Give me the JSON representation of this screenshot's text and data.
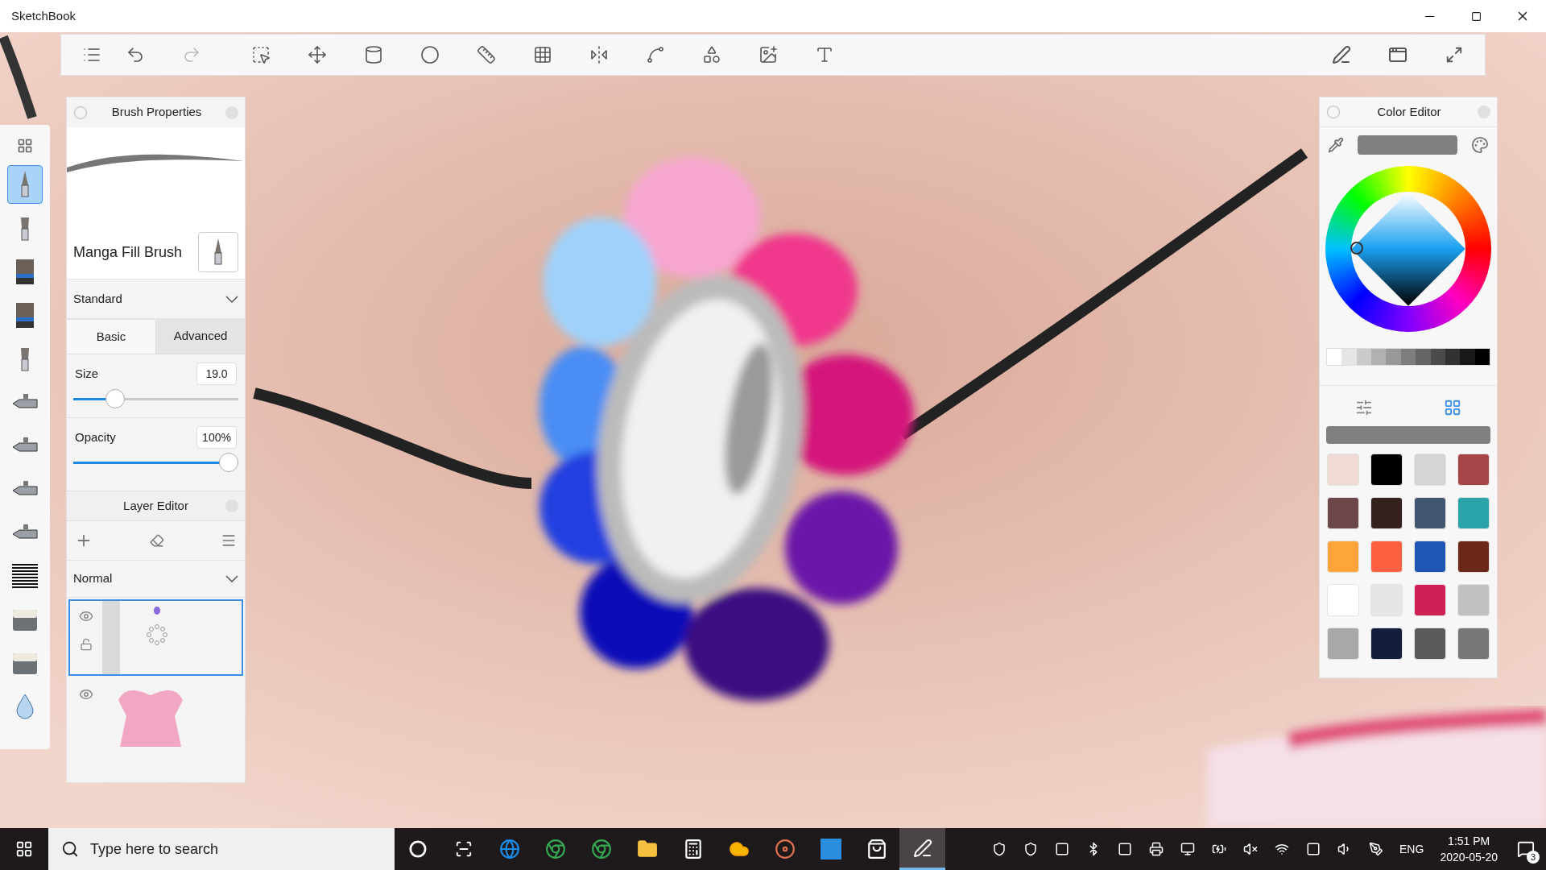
{
  "window": {
    "title": "SketchBook"
  },
  "toolbar": {
    "redo": {
      "disabled": true
    }
  },
  "brush_strip": {
    "brushes": [
      {
        "kind": "pen",
        "selected": true
      },
      {
        "kind": "brush",
        "selected": false
      },
      {
        "kind": "flat",
        "selected": false
      },
      {
        "kind": "flat",
        "selected": false
      },
      {
        "kind": "brush",
        "selected": false
      },
      {
        "kind": "airbrush",
        "selected": false
      },
      {
        "kind": "airbrush",
        "selected": false
      },
      {
        "kind": "airbrush",
        "selected": false
      },
      {
        "kind": "airbrush",
        "selected": false
      },
      {
        "kind": "hatch",
        "selected": false
      },
      {
        "kind": "eraser",
        "selected": false
      },
      {
        "kind": "eraser",
        "selected": false
      },
      {
        "kind": "drop",
        "selected": false
      }
    ]
  },
  "brush_properties": {
    "title": "Brush Properties",
    "brush_name": "Manga Fill Brush",
    "preset": "Standard",
    "tabs": [
      {
        "label": "Basic",
        "selected": true
      },
      {
        "label": "Advanced",
        "selected": false
      }
    ],
    "size": {
      "label": "Size",
      "value": "19.0",
      "level": 0.22
    },
    "opacity": {
      "label": "Opacity",
      "value": "100%",
      "level": 1.0
    }
  },
  "layer_editor": {
    "title": "Layer Editor",
    "blend_mode": "Normal",
    "layers": [
      {
        "kind": "gems",
        "selected": true,
        "visible": true
      },
      {
        "kind": "dress",
        "selected": false,
        "visible": true
      }
    ]
  },
  "color_editor": {
    "title": "Color Editor",
    "modes": [
      {
        "kind": "sliders",
        "selected": false
      },
      {
        "kind": "grid",
        "selected": true
      }
    ],
    "swatches": [
      {
        "color": "#efdbd3"
      },
      {
        "color": "#000000"
      },
      {
        "color": "#d5d5d5"
      },
      {
        "color": "#a64548"
      },
      {
        "color": "#6b4749"
      },
      {
        "color": "#35211d"
      },
      {
        "color": "#42566f"
      },
      {
        "color": "#2aa3a9"
      },
      {
        "color": "#fda53a"
      },
      {
        "color": "#fd6142"
      },
      {
        "color": "#1f56b4"
      },
      {
        "color": "#6b2818"
      },
      {
        "color": "#ffffff"
      },
      {
        "color": "#e6e6e6"
      },
      {
        "color": "#cd2055"
      },
      {
        "color": "#c0c0c0"
      },
      {
        "color": "#a8a8a8"
      },
      {
        "color": "#131e3d"
      },
      {
        "color": "#5a5a5a"
      },
      {
        "color": "#777777"
      }
    ]
  },
  "taskbar": {
    "search_placeholder": "Type here to search",
    "apps": [
      {
        "kind": "cortana",
        "active": false
      },
      {
        "kind": "taskview",
        "active": false
      },
      {
        "kind": "edge",
        "active": false
      },
      {
        "kind": "chrome",
        "active": false
      },
      {
        "kind": "chrome",
        "active": false
      },
      {
        "kind": "folder",
        "active": false
      },
      {
        "kind": "calculator",
        "active": false
      },
      {
        "kind": "weather",
        "active": false
      },
      {
        "kind": "media",
        "active": false
      },
      {
        "kind": "mu",
        "active": false
      },
      {
        "kind": "store",
        "active": false
      },
      {
        "kind": "sketchbook",
        "active": true
      }
    ],
    "language": "ENG",
    "time": "1:51 PM",
    "date": "2020-05-20",
    "notification_count": "3"
  }
}
